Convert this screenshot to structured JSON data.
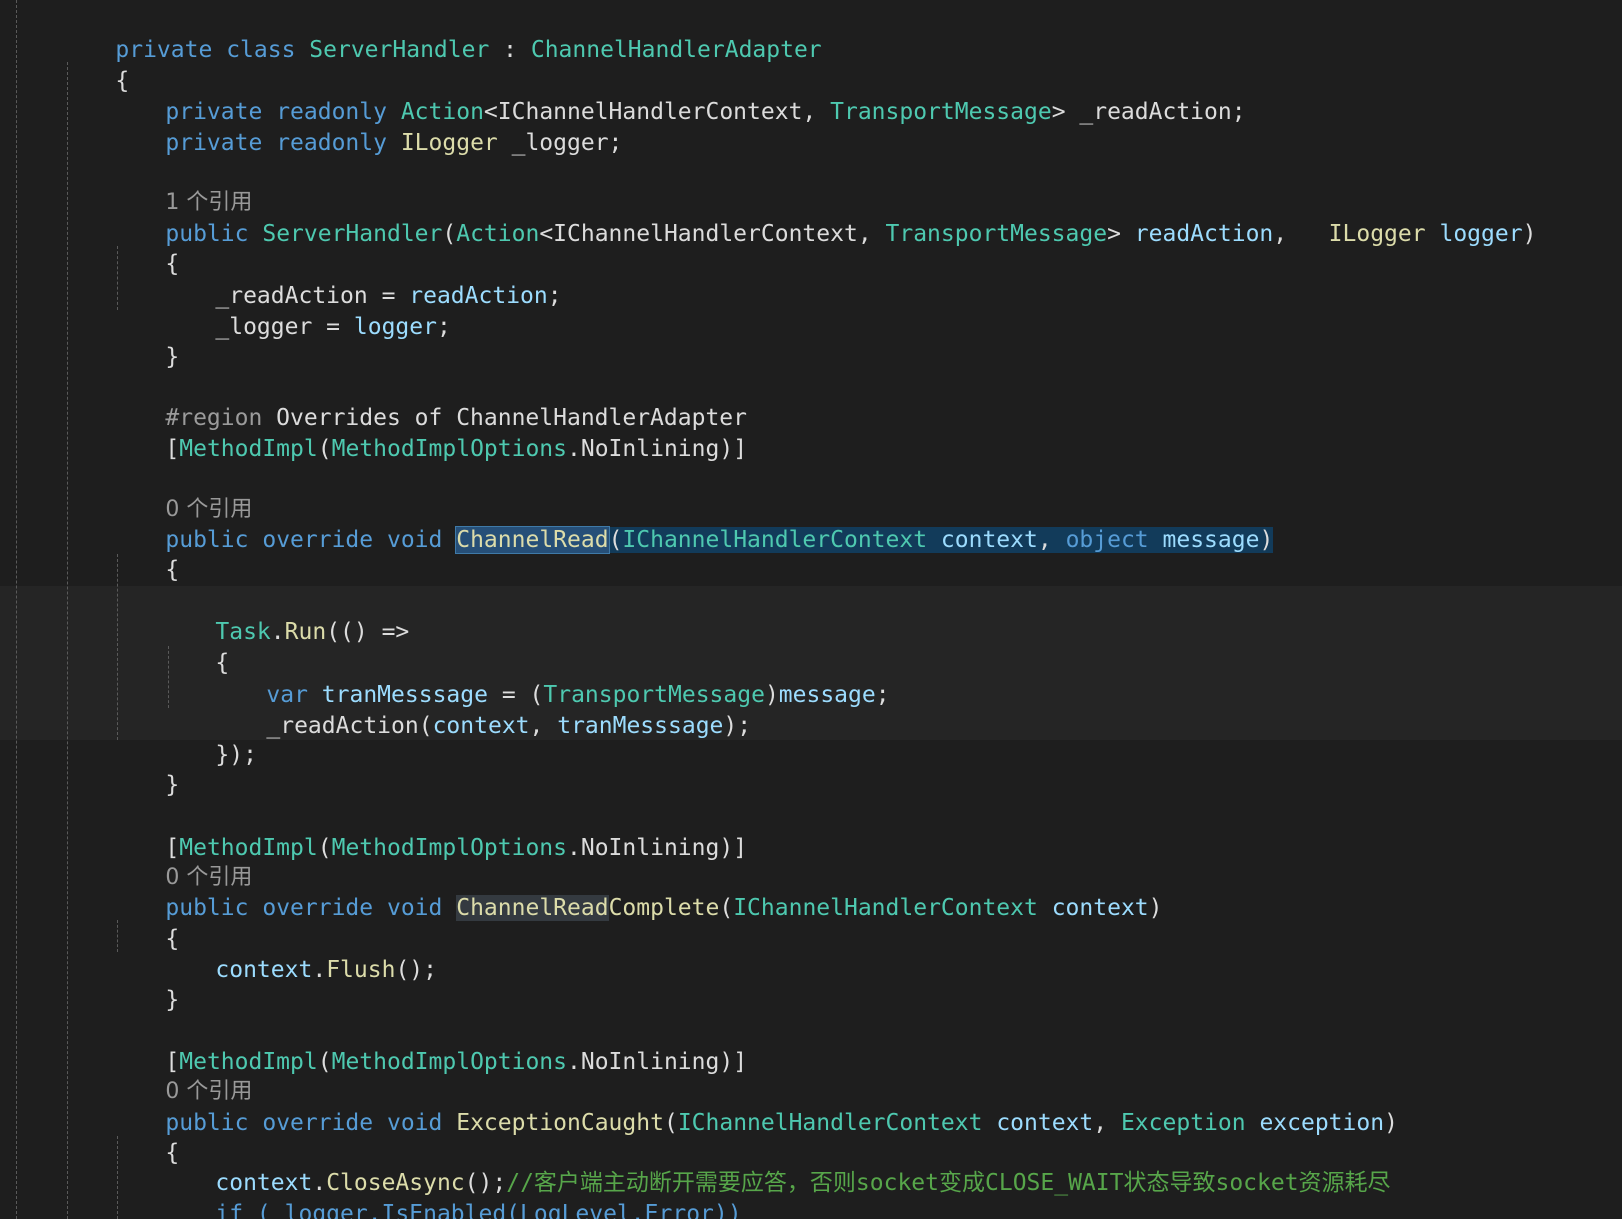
{
  "editor": {
    "class_decl": {
      "private": "private",
      "class": "class",
      "name": "ServerHandler",
      "colon": " : ",
      "base": "ChannelHandlerAdapter"
    },
    "open_brace": "{",
    "close_brace": "}",
    "field1": {
      "private": "private",
      "readonly": "readonly",
      "action": "Action",
      "lt": "<",
      "ctx_type": "IChannelHandlerContext",
      "comma": ", ",
      "msg_type": "TransportMessage",
      "gt": ">",
      "name": " _readAction;"
    },
    "field2": {
      "private": "private",
      "readonly": "readonly",
      "type": "ILogger",
      "name": " _logger;"
    },
    "ref_1": "1 个引用",
    "ref_0": "0 个引用",
    "ctor": {
      "public": "public",
      "name": "ServerHandler",
      "open": "(",
      "action": "Action",
      "lt": "<",
      "ctx_type": "IChannelHandlerContext",
      "comma": ", ",
      "msg_type": "TransportMessage",
      "gt": ">",
      "param1": "readAction",
      "comma2": ",   ",
      "logger_type": "ILogger",
      "param2": "logger",
      "close": ")"
    },
    "assign1": {
      "lhs": "_readAction",
      "eq": " = ",
      "rhs": "readAction",
      "semi": ";"
    },
    "assign2": {
      "lhs": "_logger",
      "eq": " = ",
      "rhs": "logger",
      "semi": ";"
    },
    "region": {
      "directive": "#region",
      "text": " Overrides of ChannelHandlerAdapter"
    },
    "attr": {
      "open": "[",
      "name": "MethodImpl",
      "paren": "(",
      "enum": "MethodImplOptions",
      "dot": ".",
      "value": "NoInlining",
      "close": ")]"
    },
    "channel_read": {
      "public": "public",
      "override": "override",
      "void": "void",
      "name": "ChannelRead",
      "open": "(",
      "ctx_type": "IChannelHandlerContext",
      "param1": "context",
      "comma": ", ",
      "obj": "object",
      "param2": "message",
      "close": ")"
    },
    "task_run": {
      "task": "Task",
      "dot": ".",
      "run": "Run",
      "rest": "(() =>"
    },
    "var_line": {
      "var": "var",
      "name": "tranMesssage",
      "eq": " = ",
      "cast_open": "(",
      "cast_type": "TransportMessage",
      "cast_close": ")",
      "msg": "message",
      "semi": ";"
    },
    "read_call": {
      "fn": "_readAction",
      "open": "(",
      "arg1": "context",
      "comma": ", ",
      "arg2": "tranMesssage",
      "close": ");"
    },
    "task_close": "});",
    "read_complete": {
      "public": "public",
      "override": "override",
      "void": "void",
      "name_match": "ChannelRead",
      "name_rest": "Complete",
      "open": "(",
      "ctx_type": "IChannelHandlerContext",
      "param": "context",
      "close": ")"
    },
    "flush": {
      "obj": "context",
      "dot": ".",
      "fn": "Flush",
      "rest": "();"
    },
    "exception": {
      "public": "public",
      "override": "override",
      "void": "void",
      "name": "ExceptionCaught",
      "open": "(",
      "ctx_type": "IChannelHandlerContext",
      "param1": "context",
      "comma": ", ",
      "exc_type": "Exception",
      "param2": "exception",
      "close": ")"
    },
    "close_async": {
      "obj": "context",
      "dot": ".",
      "fn": "CloseAsync",
      "rest": "();",
      "comment": "//客户端主动断开需要应答，否则socket变成CLOSE_WAIT状态导致socket资源耗尽"
    },
    "partial_line": "if (_logger.IsEnabled(LogLevel.Error))"
  }
}
